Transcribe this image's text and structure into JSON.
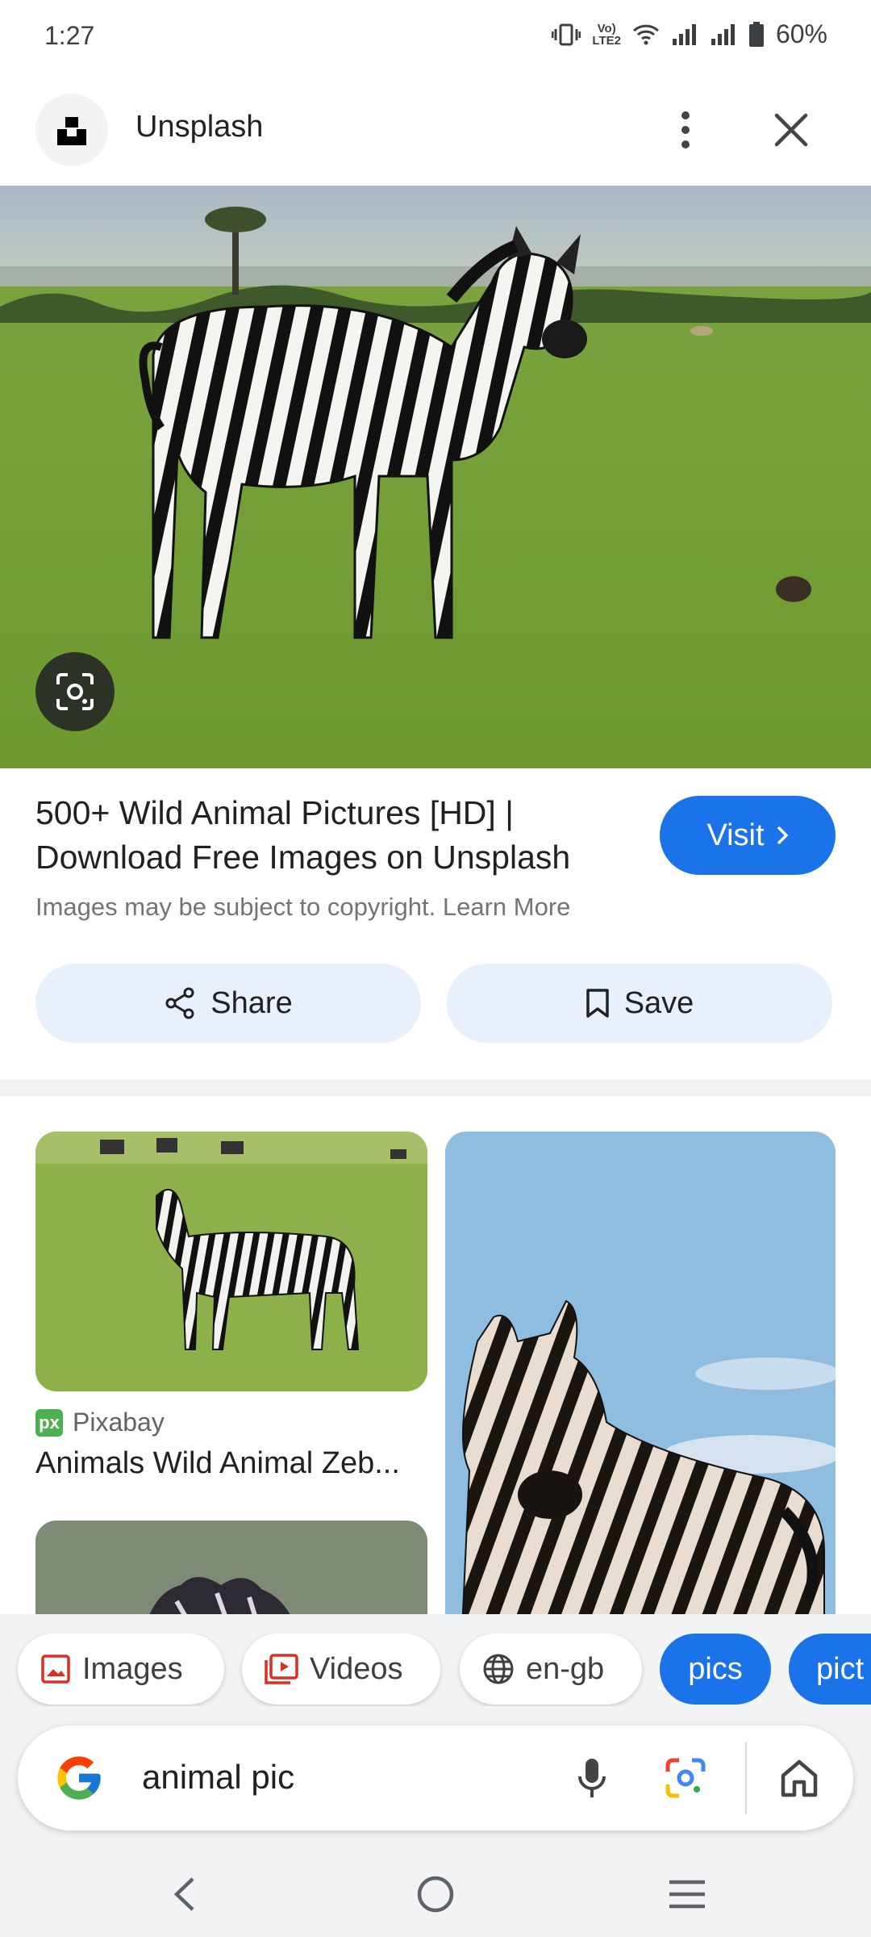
{
  "status_bar": {
    "time": "1:27",
    "network_label": "LTE2",
    "battery": "60%"
  },
  "header": {
    "site_name": "Unsplash",
    "more_icon": "more-vert-icon",
    "close_icon": "close-icon"
  },
  "result": {
    "title": "500+ Wild Animal Pictures [HD] | Download Free Images on Unsplash",
    "copyright": "Images may be subject to copyright. Learn More",
    "visit_label": "Visit",
    "share_label": "Share",
    "save_label": "Save"
  },
  "related": [
    {
      "source": "Pixabay",
      "title": "Animals Wild Animal Zeb..."
    }
  ],
  "chips": {
    "images": "Images",
    "videos": "Videos",
    "language": "en-gb",
    "pics": "pics",
    "pict": "pict"
  },
  "search": {
    "query": "animal pic"
  },
  "colors": {
    "accent": "#1a73e8",
    "chip_bg": "#e8f0fe",
    "text": "#202124",
    "muted": "#70757a"
  }
}
